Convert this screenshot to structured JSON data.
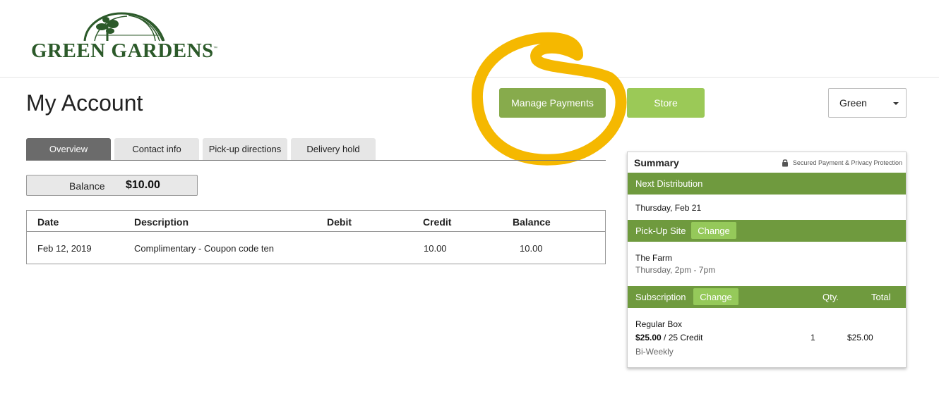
{
  "brand": {
    "name_left": "GREEN",
    "name_right": "GARDENS",
    "trademark": "™"
  },
  "page": {
    "title": "My Account"
  },
  "actions": {
    "manage_payments": "Manage Payments",
    "store": "Store"
  },
  "account_select": {
    "value": "Green"
  },
  "tabs": [
    {
      "label": "Overview",
      "active": true
    },
    {
      "label": "Contact info",
      "active": false
    },
    {
      "label": "Pick-up directions",
      "active": false
    },
    {
      "label": "Delivery hold",
      "active": false
    }
  ],
  "balance": {
    "label": "Balance",
    "value": "$10.00"
  },
  "transactions": {
    "headers": [
      "Date",
      "Description",
      "Debit",
      "Credit",
      "Balance"
    ],
    "rows": [
      {
        "date": "Feb 12, 2019",
        "description": "Complimentary - Coupon code ten",
        "debit": "",
        "credit": "10.00",
        "balance": "10.00"
      }
    ]
  },
  "summary": {
    "title": "Summary",
    "secure_note": "Secured Payment & Privacy Protection",
    "next_distribution": {
      "label": "Next Distribution",
      "value": "Thursday, Feb 21"
    },
    "pickup": {
      "label": "Pick-Up Site",
      "change": "Change",
      "site": "The Farm",
      "hours": "Thursday, 2pm - 7pm"
    },
    "subscription": {
      "label": "Subscription",
      "change": "Change",
      "qty_header": "Qty.",
      "total_header": "Total",
      "item": {
        "name": "Regular Box",
        "price": "$25.00",
        "credit": " / 25 Credit",
        "frequency": "Bi-Weekly",
        "qty": "1",
        "total": "$25.00"
      }
    }
  },
  "colors": {
    "brand_green": "#2c5a2a",
    "bar_green": "#6f9a3e",
    "button_green": "#87ab4c",
    "store_green": "#9bc957",
    "change_green": "#95c95a",
    "highlight": "#f5b800",
    "active_tab": "#6b6b6b"
  },
  "icons": [
    "greenhouse-logo-icon",
    "lock-icon",
    "caret-down-icon"
  ]
}
